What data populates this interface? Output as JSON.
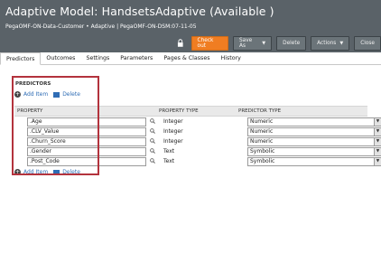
{
  "header": {
    "title": "Adaptive Model:  HandsetsAdaptive  (Available )",
    "subtitle": "PegaOMF-ON-Data-Customer • Adaptive  |  PegaOMF-ON-DSM:07-11-05"
  },
  "toolbar": {
    "check_out": "Check out",
    "save_as": "Save As",
    "delete": "Delete",
    "actions": "Actions",
    "close": "Close",
    "accent_color": "#f07d22"
  },
  "tabs": [
    "Predictors",
    "Outcomes",
    "Settings",
    "Parameters",
    "Pages & Classes",
    "History"
  ],
  "predictors": {
    "section_title": "PREDICTORS",
    "add_item": "Add Item",
    "delete": "Delete",
    "columns": {
      "property": "PROPERTY",
      "property_type": "PROPERTY TYPE",
      "predictor_type": "PREDICTOR TYPE"
    },
    "rows": [
      {
        "property": ".Age",
        "property_type": "Integer",
        "predictor_type": "Numeric"
      },
      {
        "property": ".CLV_Value",
        "property_type": "Integer",
        "predictor_type": "Numeric"
      },
      {
        "property": ".Churn_Score",
        "property_type": "Integer",
        "predictor_type": "Numeric"
      },
      {
        "property": ".Gender",
        "property_type": "Text",
        "predictor_type": "Symbolic"
      },
      {
        "property": ".Post_Code",
        "property_type": "Text",
        "predictor_type": "Symbolic"
      }
    ]
  }
}
